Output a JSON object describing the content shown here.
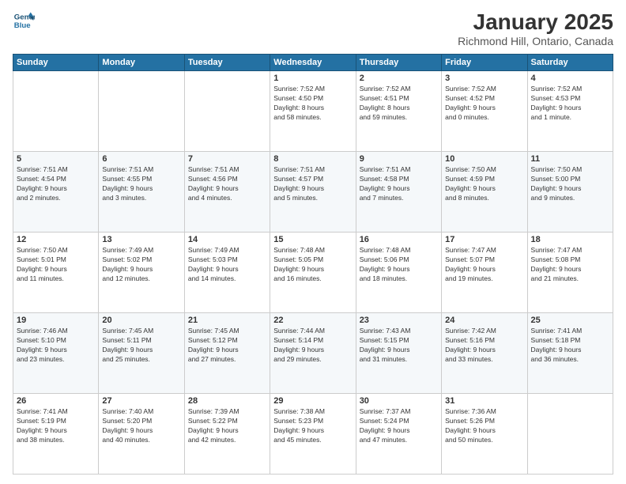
{
  "header": {
    "logo_line1": "General",
    "logo_line2": "Blue",
    "title": "January 2025",
    "subtitle": "Richmond Hill, Ontario, Canada"
  },
  "days_of_week": [
    "Sunday",
    "Monday",
    "Tuesday",
    "Wednesday",
    "Thursday",
    "Friday",
    "Saturday"
  ],
  "weeks": [
    [
      {
        "day": "",
        "info": ""
      },
      {
        "day": "",
        "info": ""
      },
      {
        "day": "",
        "info": ""
      },
      {
        "day": "1",
        "info": "Sunrise: 7:52 AM\nSunset: 4:50 PM\nDaylight: 8 hours\nand 58 minutes."
      },
      {
        "day": "2",
        "info": "Sunrise: 7:52 AM\nSunset: 4:51 PM\nDaylight: 8 hours\nand 59 minutes."
      },
      {
        "day": "3",
        "info": "Sunrise: 7:52 AM\nSunset: 4:52 PM\nDaylight: 9 hours\nand 0 minutes."
      },
      {
        "day": "4",
        "info": "Sunrise: 7:52 AM\nSunset: 4:53 PM\nDaylight: 9 hours\nand 1 minute."
      }
    ],
    [
      {
        "day": "5",
        "info": "Sunrise: 7:51 AM\nSunset: 4:54 PM\nDaylight: 9 hours\nand 2 minutes."
      },
      {
        "day": "6",
        "info": "Sunrise: 7:51 AM\nSunset: 4:55 PM\nDaylight: 9 hours\nand 3 minutes."
      },
      {
        "day": "7",
        "info": "Sunrise: 7:51 AM\nSunset: 4:56 PM\nDaylight: 9 hours\nand 4 minutes."
      },
      {
        "day": "8",
        "info": "Sunrise: 7:51 AM\nSunset: 4:57 PM\nDaylight: 9 hours\nand 5 minutes."
      },
      {
        "day": "9",
        "info": "Sunrise: 7:51 AM\nSunset: 4:58 PM\nDaylight: 9 hours\nand 7 minutes."
      },
      {
        "day": "10",
        "info": "Sunrise: 7:50 AM\nSunset: 4:59 PM\nDaylight: 9 hours\nand 8 minutes."
      },
      {
        "day": "11",
        "info": "Sunrise: 7:50 AM\nSunset: 5:00 PM\nDaylight: 9 hours\nand 9 minutes."
      }
    ],
    [
      {
        "day": "12",
        "info": "Sunrise: 7:50 AM\nSunset: 5:01 PM\nDaylight: 9 hours\nand 11 minutes."
      },
      {
        "day": "13",
        "info": "Sunrise: 7:49 AM\nSunset: 5:02 PM\nDaylight: 9 hours\nand 12 minutes."
      },
      {
        "day": "14",
        "info": "Sunrise: 7:49 AM\nSunset: 5:03 PM\nDaylight: 9 hours\nand 14 minutes."
      },
      {
        "day": "15",
        "info": "Sunrise: 7:48 AM\nSunset: 5:05 PM\nDaylight: 9 hours\nand 16 minutes."
      },
      {
        "day": "16",
        "info": "Sunrise: 7:48 AM\nSunset: 5:06 PM\nDaylight: 9 hours\nand 18 minutes."
      },
      {
        "day": "17",
        "info": "Sunrise: 7:47 AM\nSunset: 5:07 PM\nDaylight: 9 hours\nand 19 minutes."
      },
      {
        "day": "18",
        "info": "Sunrise: 7:47 AM\nSunset: 5:08 PM\nDaylight: 9 hours\nand 21 minutes."
      }
    ],
    [
      {
        "day": "19",
        "info": "Sunrise: 7:46 AM\nSunset: 5:10 PM\nDaylight: 9 hours\nand 23 minutes."
      },
      {
        "day": "20",
        "info": "Sunrise: 7:45 AM\nSunset: 5:11 PM\nDaylight: 9 hours\nand 25 minutes."
      },
      {
        "day": "21",
        "info": "Sunrise: 7:45 AM\nSunset: 5:12 PM\nDaylight: 9 hours\nand 27 minutes."
      },
      {
        "day": "22",
        "info": "Sunrise: 7:44 AM\nSunset: 5:14 PM\nDaylight: 9 hours\nand 29 minutes."
      },
      {
        "day": "23",
        "info": "Sunrise: 7:43 AM\nSunset: 5:15 PM\nDaylight: 9 hours\nand 31 minutes."
      },
      {
        "day": "24",
        "info": "Sunrise: 7:42 AM\nSunset: 5:16 PM\nDaylight: 9 hours\nand 33 minutes."
      },
      {
        "day": "25",
        "info": "Sunrise: 7:41 AM\nSunset: 5:18 PM\nDaylight: 9 hours\nand 36 minutes."
      }
    ],
    [
      {
        "day": "26",
        "info": "Sunrise: 7:41 AM\nSunset: 5:19 PM\nDaylight: 9 hours\nand 38 minutes."
      },
      {
        "day": "27",
        "info": "Sunrise: 7:40 AM\nSunset: 5:20 PM\nDaylight: 9 hours\nand 40 minutes."
      },
      {
        "day": "28",
        "info": "Sunrise: 7:39 AM\nSunset: 5:22 PM\nDaylight: 9 hours\nand 42 minutes."
      },
      {
        "day": "29",
        "info": "Sunrise: 7:38 AM\nSunset: 5:23 PM\nDaylight: 9 hours\nand 45 minutes."
      },
      {
        "day": "30",
        "info": "Sunrise: 7:37 AM\nSunset: 5:24 PM\nDaylight: 9 hours\nand 47 minutes."
      },
      {
        "day": "31",
        "info": "Sunrise: 7:36 AM\nSunset: 5:26 PM\nDaylight: 9 hours\nand 50 minutes."
      },
      {
        "day": "",
        "info": ""
      }
    ]
  ]
}
